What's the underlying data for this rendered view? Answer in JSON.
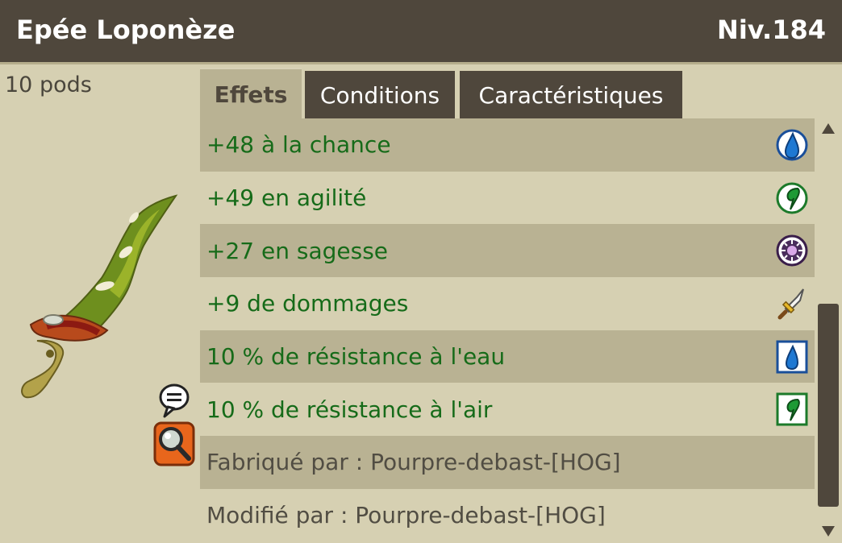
{
  "item": {
    "name": "Epée Loponèze",
    "level": "Niv.184",
    "weight": "10 pods"
  },
  "tabs": [
    {
      "label": "Effets",
      "active": true
    },
    {
      "label": "Conditions",
      "active": false
    },
    {
      "label": "Caractéristiques",
      "active": false
    }
  ],
  "effects": [
    {
      "text": "+48 à la chance",
      "icon": "water-drop-circle-icon"
    },
    {
      "text": "+49 en agilité",
      "icon": "air-swirl-circle-icon"
    },
    {
      "text": "+27 en sagesse",
      "icon": "wisdom-eye-circle-icon"
    },
    {
      "text": "+9 de dommages",
      "icon": "sword-icon"
    },
    {
      "text": "10 % de résistance à l'eau",
      "icon": "water-drop-square-icon"
    },
    {
      "text": "10 % de résistance à l'air",
      "icon": "air-swirl-square-icon"
    }
  ],
  "crafted_by": "Fabriqué par : Pourpre-debast-[HOG]",
  "modified_by": "Modifié par : Pourpre-debast-[HOG]",
  "colors": {
    "header_bg": "#4f473c",
    "effect_text": "#166b19",
    "row_dark": "#b9b293",
    "row_light": "#d6d0b2"
  }
}
